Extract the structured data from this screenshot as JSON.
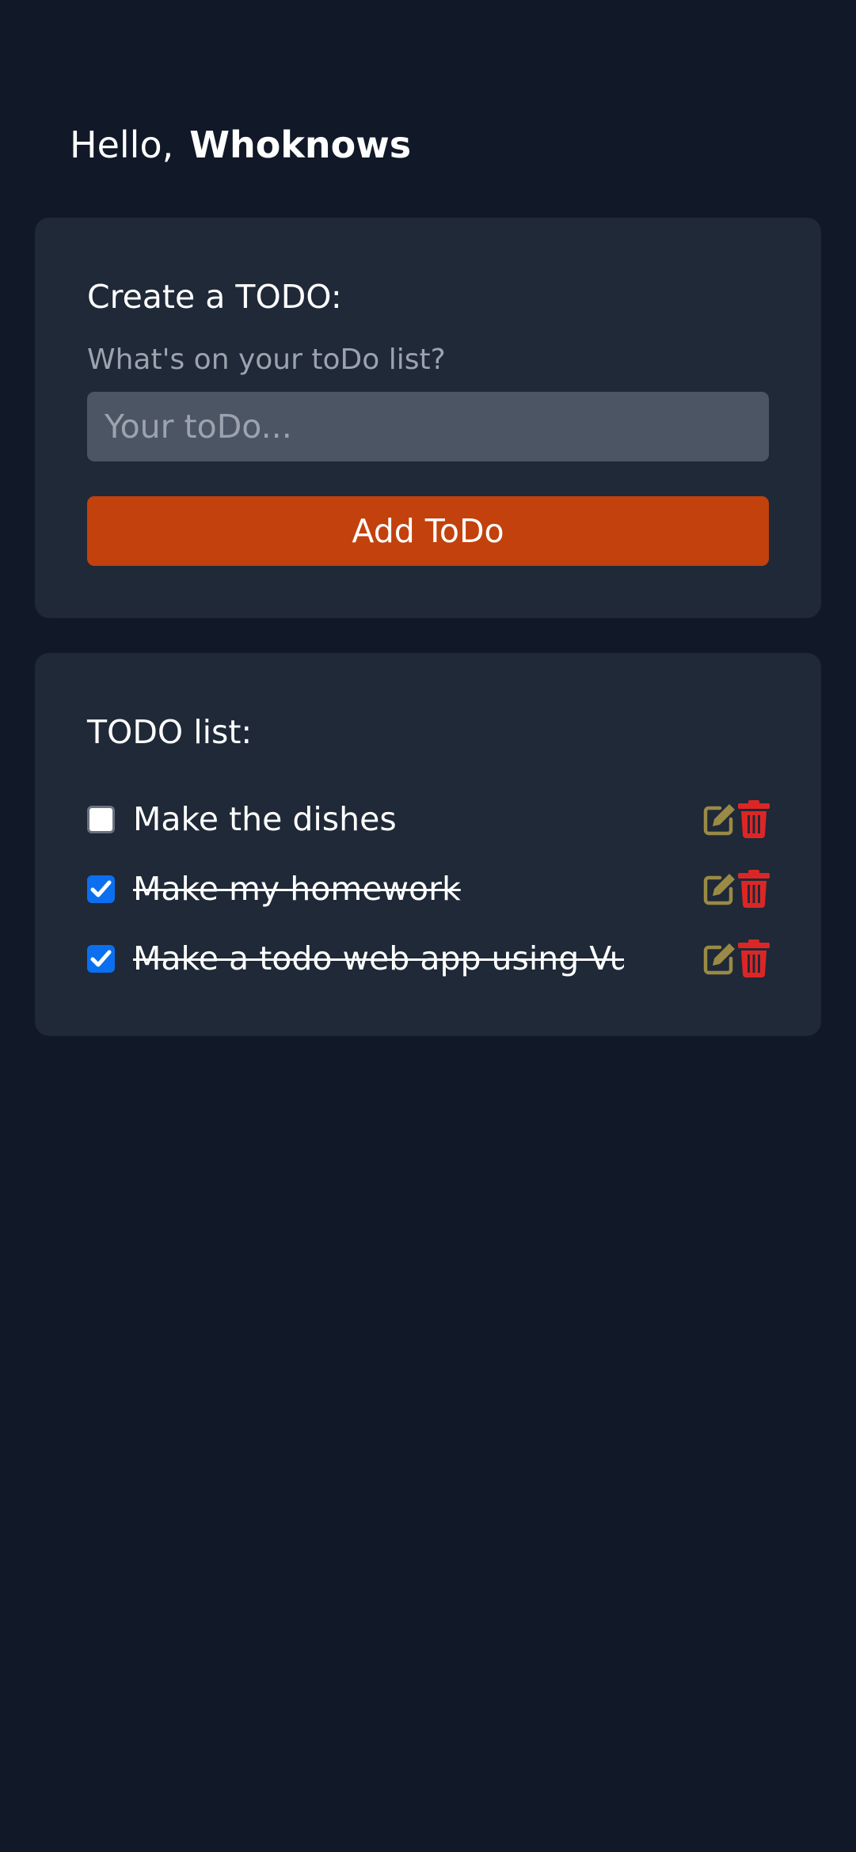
{
  "greeting": {
    "prefix": "Hello,",
    "name": "Whoknows"
  },
  "create": {
    "title": "Create a TODO:",
    "label": "What's on your toDo list?",
    "input_placeholder": "Your toDo...",
    "input_value": "",
    "button_label": "Add ToDo"
  },
  "list": {
    "title": "TODO list:",
    "items": [
      {
        "text": "Make the dishes",
        "done": false
      },
      {
        "text": "Make my homework",
        "done": true
      },
      {
        "text": "Make a todo web app using Vue",
        "done": true
      }
    ]
  },
  "icons": {
    "edit": "edit-icon",
    "delete": "trash-icon",
    "check": "checkmark-icon"
  },
  "colors": {
    "background": "#111827",
    "card": "#1f2937",
    "input": "#4b5563",
    "accent": "#c2410c",
    "edit_icon": "#9a8a45",
    "delete_icon": "#dc2626",
    "checkbox_checked": "#0b6ff0"
  }
}
